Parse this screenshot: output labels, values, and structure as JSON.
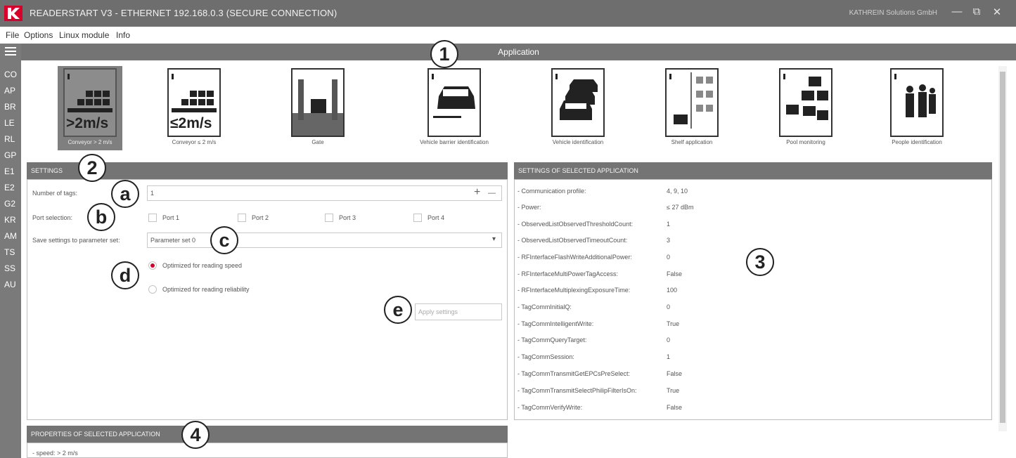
{
  "titlebar": {
    "title": "READERSTART V3 - ETHERNET 192.168.0.3 (SECURE CONNECTION)",
    "company": "KATHREIN Solutions GmbH",
    "minimize": "—",
    "maximize": "⧉",
    "close": "✕"
  },
  "menu": {
    "items": [
      "File",
      "Options",
      "Linux module",
      "Info"
    ]
  },
  "leftnav": {
    "items": [
      "CO",
      "AP",
      "BR",
      "LE",
      "RL",
      "GP",
      "E1",
      "E2",
      "G2",
      "KR",
      "AM",
      "TS",
      "SS",
      "AU"
    ]
  },
  "application": {
    "header": "Application",
    "tiles": [
      {
        "label": "Conveyor > 2 m/s",
        "speed_text": ">2m/s"
      },
      {
        "label": "Conveyor ≤ 2 m/s",
        "speed_text": "≤2m/s"
      },
      {
        "label": "Gate"
      },
      {
        "label": "Vehicle barrier identification"
      },
      {
        "label": "Vehicle identification"
      },
      {
        "label": "Shelf application"
      },
      {
        "label": "Pool monitoring"
      },
      {
        "label": "People identification"
      }
    ]
  },
  "settings": {
    "header": "SETTINGS",
    "num_tags_label": "Number of tags:",
    "num_tags_value": "1",
    "plus": "+",
    "minus": "—",
    "port_label": "Port selection:",
    "ports": [
      "Port 1",
      "Port 2",
      "Port 3",
      "Port 4"
    ],
    "param_label": "Save settings to parameter set:",
    "param_value": "Parameter set 0",
    "param_arrow": "▾",
    "radio_speed": "Optimized for reading speed",
    "radio_reliability": "Optimized for reading reliability",
    "apply": "Apply settings"
  },
  "selected_app": {
    "header": "SETTINGS OF SELECTED APPLICATION",
    "rows": [
      {
        "name": "- Communication profile:",
        "value": "4, 9, 10"
      },
      {
        "name": "- Power:",
        "value": "≤ 27 dBm"
      },
      {
        "name": "- ObservedListObservedThresholdCount:",
        "value": "1"
      },
      {
        "name": "- ObservedListObservedTimeoutCount:",
        "value": "3"
      },
      {
        "name": "- RFInterfaceFlashWriteAdditionalPower:",
        "value": "0"
      },
      {
        "name": "- RFInterfaceMultiPowerTagAccess:",
        "value": "False"
      },
      {
        "name": "- RFInterfaceMultiplexingExposureTime:",
        "value": "100"
      },
      {
        "name": "- TagCommInitialQ:",
        "value": "0"
      },
      {
        "name": "- TagCommIntelligentWrite:",
        "value": "True"
      },
      {
        "name": "- TagCommQueryTarget:",
        "value": "0"
      },
      {
        "name": "- TagCommSession:",
        "value": "1"
      },
      {
        "name": "- TagCommTransmitGetEPCsPreSelect:",
        "value": "False"
      },
      {
        "name": "- TagCommTransmitSelectPhilipFilterIsOn:",
        "value": "True"
      },
      {
        "name": "- TagCommVerifyWrite:",
        "value": "False"
      }
    ]
  },
  "properties": {
    "header": "PROPERTIES OF SELECTED APPLICATION",
    "line1": "- speed: > 2 m/s"
  },
  "callouts": [
    "1",
    "2",
    "3",
    "4",
    "a",
    "b",
    "c",
    "d",
    "e"
  ],
  "colors": {
    "brand_red": "#d6002a",
    "titlebar": "#6e6e6e",
    "header_gray": "#747474"
  }
}
